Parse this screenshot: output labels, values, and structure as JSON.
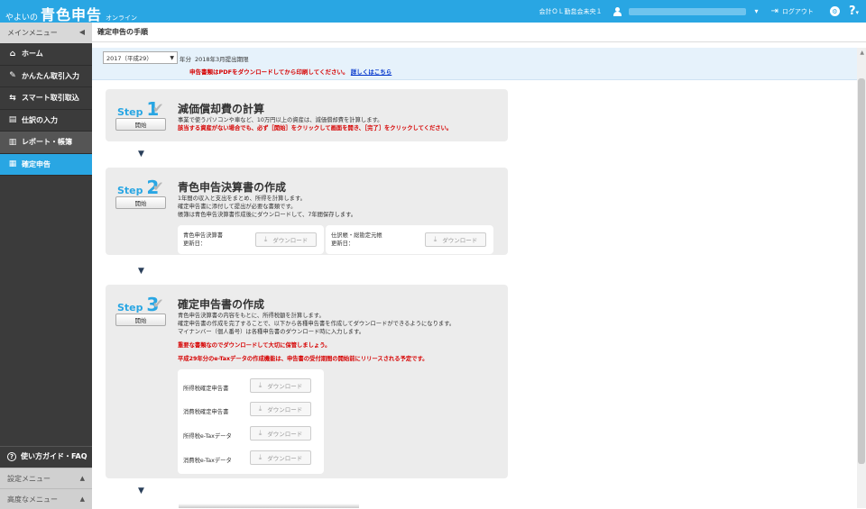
{
  "header": {
    "brand_pre": "やよいの",
    "brand_main": "青色申告",
    "brand_post": "オンライン",
    "company": "会計ＯＬ勤怠会未央１",
    "logout": "ログアウト",
    "help_char": "?"
  },
  "sidebar": {
    "title": "メインメニュー",
    "items": [
      {
        "label": "ホーム",
        "icon": "home-icon",
        "glyph": "⌂"
      },
      {
        "label": "かんたん取引入力",
        "icon": "pencil-icon",
        "glyph": "✎"
      },
      {
        "label": "スマート取引取込",
        "icon": "import-icon",
        "glyph": "⇆"
      },
      {
        "label": "仕訳の入力",
        "icon": "journal-icon",
        "glyph": "▤"
      },
      {
        "label": "レポート・帳簿",
        "icon": "report-icon",
        "glyph": "▥"
      },
      {
        "label": "確定申告",
        "icon": "tax-icon",
        "glyph": "▦"
      }
    ],
    "guide": "使い方ガイド・FAQ",
    "settings": "設定メニュー",
    "advanced": "高度なメニュー"
  },
  "page": {
    "title": "確定申告の手順",
    "year_select": "2017（平成29）",
    "year_label": "年分",
    "deadline": "2018年3月提出期限",
    "pdf_note": "申告書類はPDFをダウンロードしてから印刷してください。",
    "pdf_link": "詳しくはこちら"
  },
  "steps": {
    "word": "Step",
    "start": "開始",
    "download": "ダウンロード",
    "update_label": "更新日：",
    "s1": {
      "num": "1",
      "title": "減価償却費の計算",
      "desc1": "事業で使うパソコンや車など、10万円以上の資産は、減価償却費を計算します。",
      "desc2": "該当する資産がない場合でも、必ず［開始］をクリックして画面を開き、［完了］をクリックしてください。"
    },
    "s2": {
      "num": "2",
      "title": "青色申告決算書の作成",
      "desc1": "1年間の収入と支出をまとめ、所得を計算します。",
      "desc2": "確定申告書に添付して提出が必要な書類です。",
      "desc3": "帳簿は青色申告決算書作成後にダウンロードして、7年間保存します。",
      "doc1": "青色申告決算書",
      "doc2": "仕訳帳・総勘定元帳"
    },
    "s3": {
      "num": "3",
      "title": "確定申告書の作成",
      "desc1": "青色申告決算書の内容をもとに、所得税額を計算します。",
      "desc2": "確定申告書の作成を完了することで、以下から各種申告書を作成してダウンロードができるようになります。",
      "desc3": "マイナンバー（個人番号）は各種申告書のダウンロード時に入力します。",
      "red1": "重要な書類なのでダウンロードして大切に保管しましょう。",
      "red2": "平成29年分のe-Taxデータの作成機能は、申告書の受付期間の開始前にリリースされる予定です。",
      "docs": [
        "所得税確定申告書",
        "消費税確定申告書",
        "所得税e-Taxデータ",
        "消費税e-Taxデータ"
      ]
    }
  }
}
